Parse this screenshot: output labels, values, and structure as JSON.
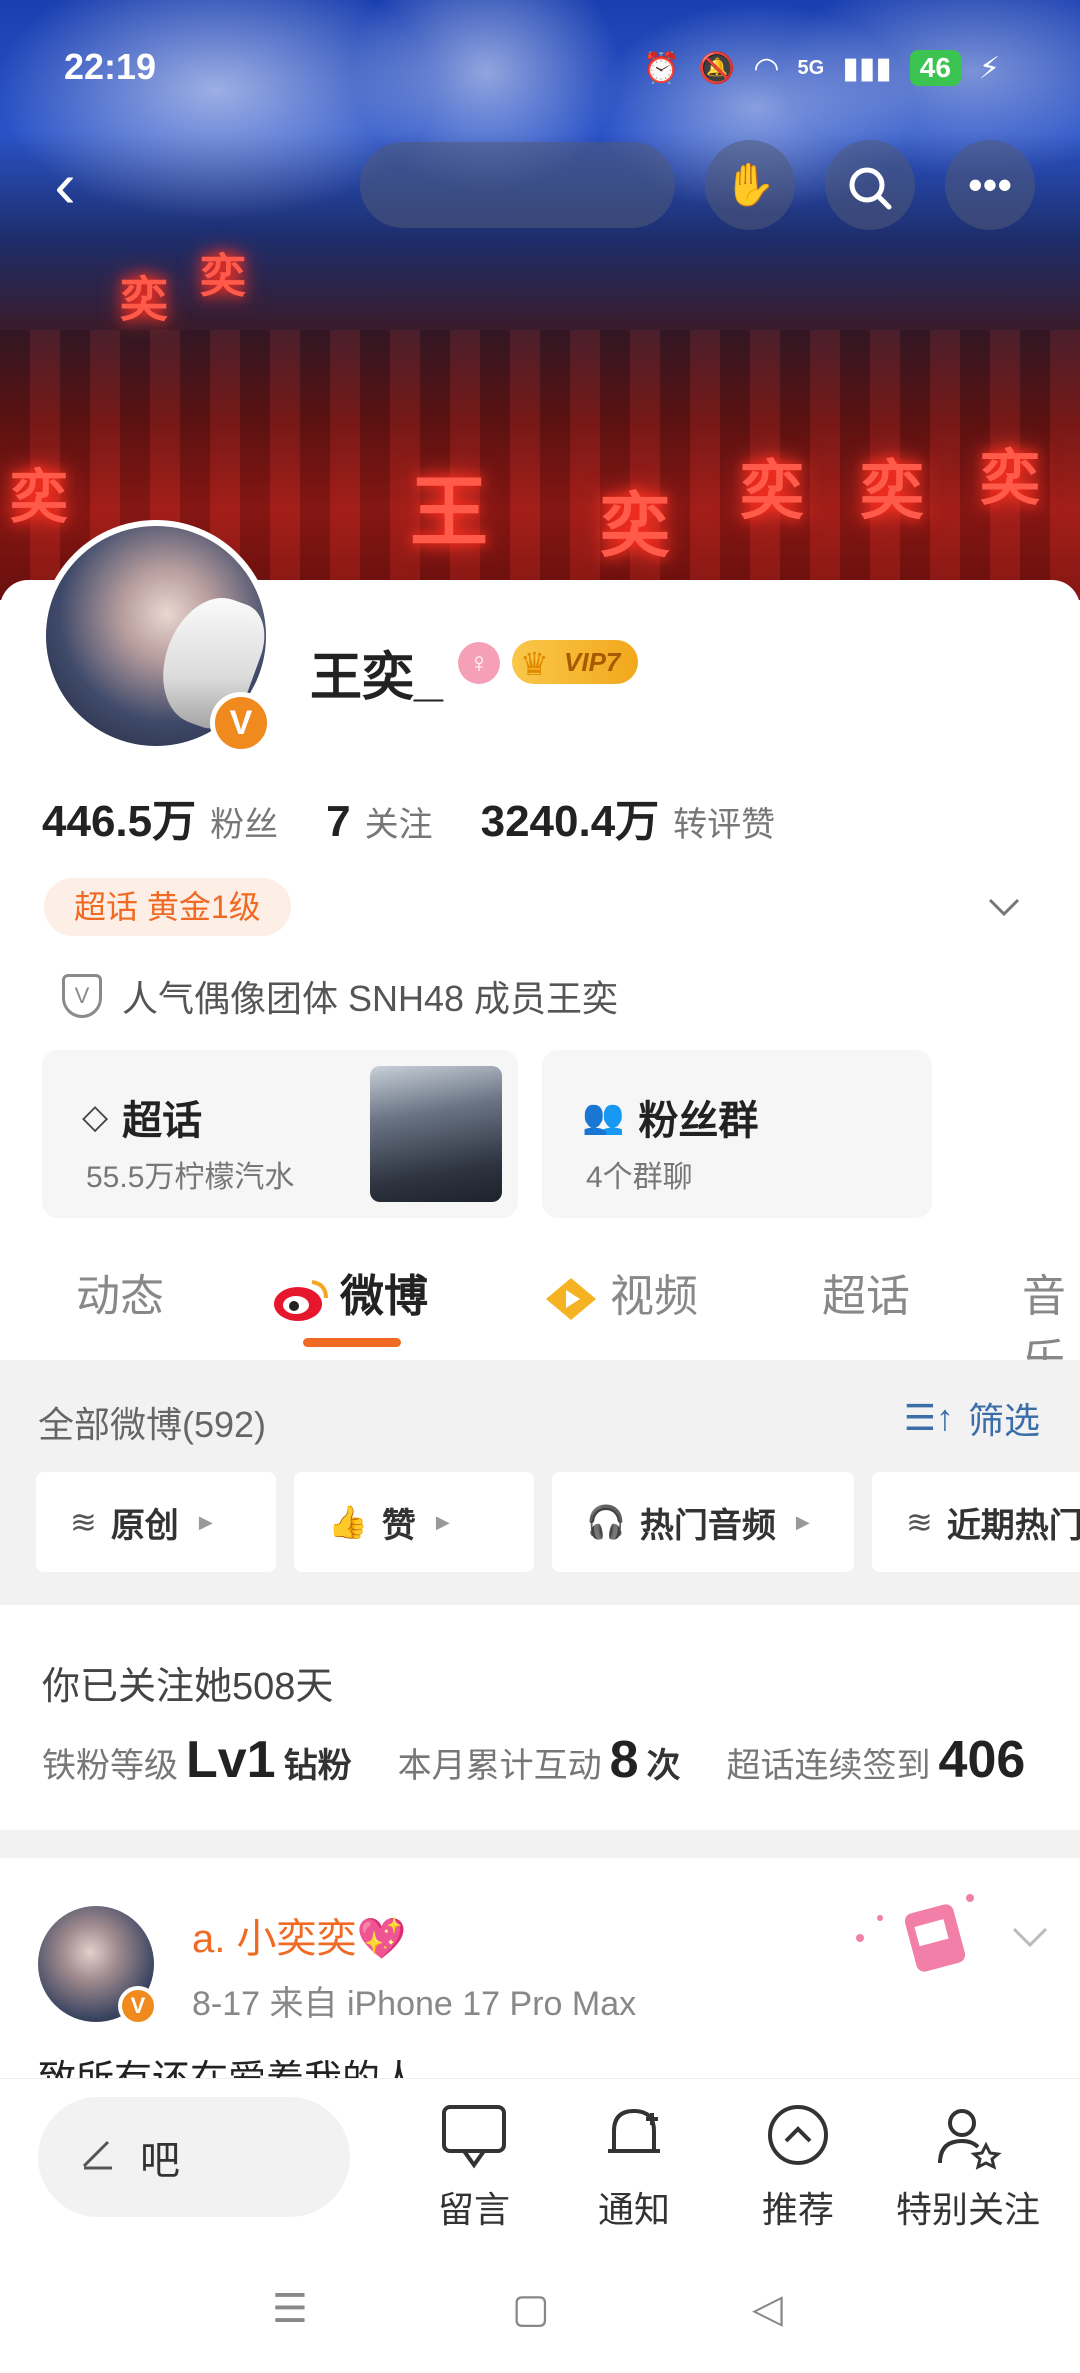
{
  "status_bar": {
    "time": "22:19",
    "network": "5G",
    "battery": "46"
  },
  "profile": {
    "name": "王奕_",
    "vip_label": "VIP7",
    "stats": [
      {
        "value": "446.5万",
        "label": "粉丝"
      },
      {
        "value": "7",
        "label": "关注"
      },
      {
        "value": "3240.4万",
        "label": "转评赞"
      }
    ],
    "tag": "超话 黄金1级",
    "description": "人气偶像团体 SNH48 成员王奕"
  },
  "boxes": {
    "super_topic": {
      "title": "超话",
      "sub": "55.5万柠檬汽水"
    },
    "fan_group": {
      "title": "粉丝群",
      "sub": "4个群聊"
    }
  },
  "tabs": [
    {
      "label": "动态",
      "active": false
    },
    {
      "label": "微博",
      "active": true
    },
    {
      "label": "视频",
      "active": false
    },
    {
      "label": "超话",
      "active": false
    },
    {
      "label": "音乐",
      "active": false
    }
  ],
  "filter": {
    "title": "全部微博(592)",
    "button": "筛选",
    "chips": [
      "原创",
      "赞",
      "热门音频",
      "近期热门"
    ]
  },
  "follow": {
    "title": "你已关注她508天",
    "level_label": "铁粉等级",
    "level_value": "Lv1",
    "level_unit": "钻粉",
    "interact_label": "本月累计互动",
    "interact_value": "8",
    "interact_unit": "次",
    "checkin_label": "超话连续签到",
    "checkin_value": "406"
  },
  "post": {
    "author": "a. 小奕奕💖",
    "meta": "8-17  来自 iPhone 17 Pro Max",
    "text": "致所有还在爱着我的人"
  },
  "bottom_bar": {
    "comment_placeholder": "吧",
    "items": [
      "留言",
      "通知",
      "推荐",
      "特别关注"
    ]
  },
  "banner_text": [
    "奕",
    "奕",
    "奕",
    "王",
    "奕",
    "奕",
    "奕",
    "奕"
  ],
  "colors": {
    "accent": "#f06a24",
    "link": "#3b6ea8",
    "vip_gold": "#f2a81c"
  }
}
